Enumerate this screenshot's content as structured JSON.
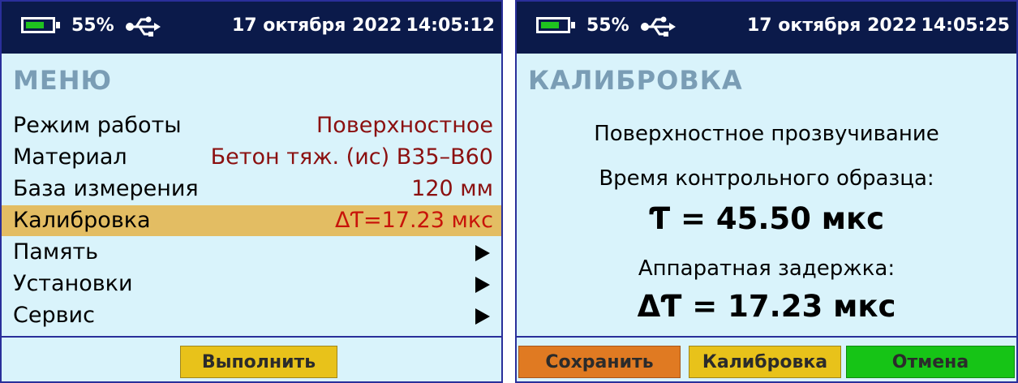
{
  "left_screen": {
    "status": {
      "battery": "55%",
      "date": "17 октября 2022",
      "time": "14:05:12"
    },
    "title": "МЕНЮ",
    "menu": [
      {
        "label": "Режим работы",
        "value": "Поверхностное"
      },
      {
        "label": "Материал",
        "value": "Бетон тяж. (ис) В35–В60"
      },
      {
        "label": "База измерения",
        "value": "120 мм"
      },
      {
        "label": "Калибровка",
        "value": "ΔƬ=17.23 мкс"
      },
      {
        "label": "Память"
      },
      {
        "label": "Установки"
      },
      {
        "label": "Сервис"
      }
    ],
    "button": "Выполнить"
  },
  "right_screen": {
    "status": {
      "battery": "55%",
      "date": "17 октября 2022",
      "time": "14:05:25"
    },
    "title": "КАЛИБРОВКА",
    "mode": "Поверхностное прозвучивание",
    "sample_label": "Время контрольного образца:",
    "sample_value": "Ƭ = 45.50 мкс",
    "delay_label": "Аппаратная задержка:",
    "delay_value": "ΔƬ = 17.23 мкс",
    "buttons": {
      "save": "Сохранить",
      "calibrate": "Калибровка",
      "cancel": "Отмена"
    }
  },
  "colors": {
    "screen_bg": "#d9f3fb",
    "status_bar": "#0b1a4a",
    "battery_fill": "#1fc21f",
    "title": "#7a9db5",
    "selected_row": "#e3bd63",
    "value_text": "#8b1010",
    "btn_yellow": "#e8c21a",
    "btn_orange": "#e07a22",
    "btn_green": "#16c416"
  },
  "icons": [
    "battery-icon",
    "usb-icon",
    "arrow-right-icon"
  ]
}
